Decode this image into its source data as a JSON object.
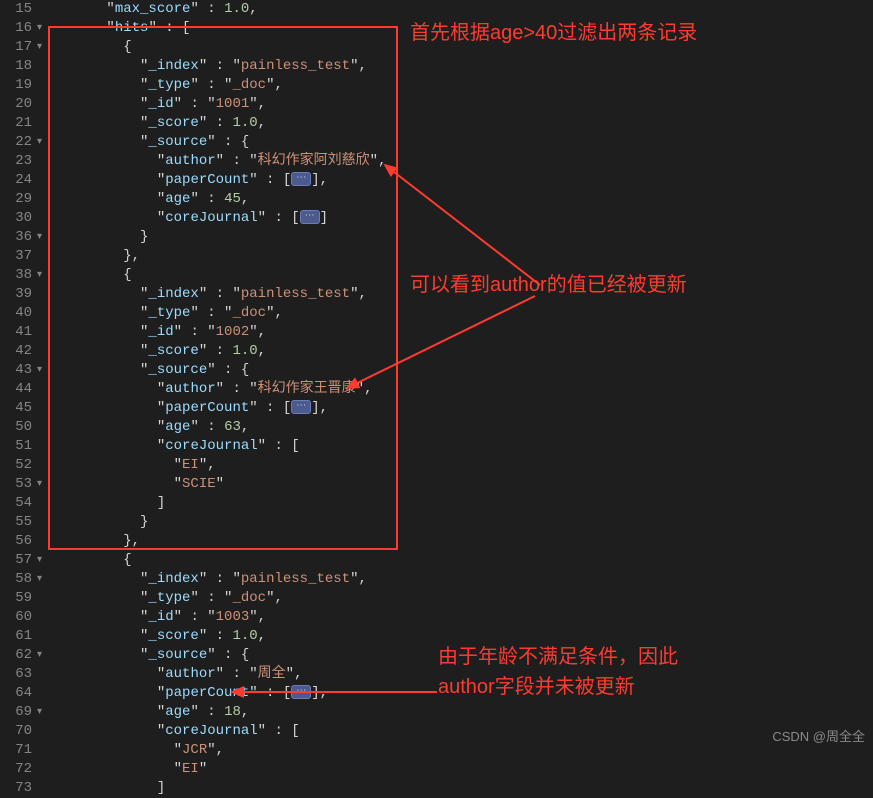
{
  "gutter": [
    "15",
    "16",
    "17",
    "18",
    "19",
    "20",
    "21",
    "22",
    "23",
    "24",
    "29",
    "30",
    "36",
    "37",
    "38",
    "39",
    "40",
    "41",
    "42",
    "43",
    "44",
    "45",
    "50",
    "51",
    "52",
    "53",
    "54",
    "55",
    "56",
    "57",
    "58",
    "59",
    "60",
    "61",
    "62",
    "63",
    "64",
    "69",
    "70",
    "71",
    "72",
    "73"
  ],
  "folds": [
    1,
    2,
    7,
    12,
    14,
    19,
    25,
    29,
    30,
    34,
    37
  ],
  "lines": {
    "l0": {
      "indent": 6,
      "pre": "\"",
      "key": "max_score",
      "post": "\" : ",
      "val_num": "1.0",
      "trail": ","
    },
    "l1": {
      "indent": 6,
      "pre": "\"",
      "key": "hits",
      "post": "\" : ["
    },
    "l2": {
      "indent": 8,
      "plain": "{"
    },
    "l3": {
      "indent": 10,
      "pre": "\"",
      "key": "_index",
      "post": "\" : \"",
      "val_str": "painless_test",
      "trail": "\","
    },
    "l4": {
      "indent": 10,
      "pre": "\"",
      "key": "_type",
      "post": "\" : \"",
      "val_str": "_doc",
      "trail": "\","
    },
    "l5": {
      "indent": 10,
      "pre": "\"",
      "key": "_id",
      "post": "\" : \"",
      "val_str": "1001",
      "trail": "\","
    },
    "l6": {
      "indent": 10,
      "pre": "\"",
      "key": "_score",
      "post": "\" : ",
      "val_num": "1.0",
      "trail": ","
    },
    "l7": {
      "indent": 10,
      "pre": "\"",
      "key": "_source",
      "post": "\" : {"
    },
    "l8": {
      "indent": 12,
      "pre": "\"",
      "key": "author",
      "post": "\" : \"",
      "val_str": "科幻作家阿刘慈欣",
      "trail": "\","
    },
    "l9": {
      "indent": 12,
      "pre": "\"",
      "key": "paperCount",
      "post": "\" : [",
      "badge": "⋯",
      "trail": "],"
    },
    "l10": {
      "indent": 12,
      "pre": "\"",
      "key": "age",
      "post": "\" : ",
      "val_num": "45",
      "trail": ","
    },
    "l11": {
      "indent": 12,
      "pre": "\"",
      "key": "coreJournal",
      "post": "\" : [",
      "badge": "⋯",
      "trail": "]"
    },
    "l12": {
      "indent": 10,
      "plain": "}"
    },
    "l13": {
      "indent": 8,
      "plain": "},"
    },
    "l14": {
      "indent": 8,
      "plain": "{"
    },
    "l15": {
      "indent": 10,
      "pre": "\"",
      "key": "_index",
      "post": "\" : \"",
      "val_str": "painless_test",
      "trail": "\","
    },
    "l16": {
      "indent": 10,
      "pre": "\"",
      "key": "_type",
      "post": "\" : \"",
      "val_str": "_doc",
      "trail": "\","
    },
    "l17": {
      "indent": 10,
      "pre": "\"",
      "key": "_id",
      "post": "\" : \"",
      "val_str": "1002",
      "trail": "\","
    },
    "l18": {
      "indent": 10,
      "pre": "\"",
      "key": "_score",
      "post": "\" : ",
      "val_num": "1.0",
      "trail": ","
    },
    "l19": {
      "indent": 10,
      "pre": "\"",
      "key": "_source",
      "post": "\" : {"
    },
    "l20": {
      "indent": 12,
      "pre": "\"",
      "key": "author",
      "post": "\" : \"",
      "val_str": "科幻作家王晋康",
      "trail": "\","
    },
    "l21": {
      "indent": 12,
      "pre": "\"",
      "key": "paperCount",
      "post": "\" : [",
      "badge": "⋯",
      "trail": "],"
    },
    "l22": {
      "indent": 12,
      "pre": "\"",
      "key": "age",
      "post": "\" : ",
      "val_num": "63",
      "trail": ","
    },
    "l23": {
      "indent": 12,
      "pre": "\"",
      "key": "coreJournal",
      "post": "\" : ["
    },
    "l24": {
      "indent": 14,
      "pre": "\"",
      "val_str": "EI",
      "trail": "\","
    },
    "l25": {
      "indent": 14,
      "pre": "\"",
      "val_str": "SCIE",
      "trail": "\""
    },
    "l26": {
      "indent": 12,
      "plain": "]"
    },
    "l27": {
      "indent": 10,
      "plain": "}"
    },
    "l28": {
      "indent": 8,
      "plain": "},"
    },
    "l29": {
      "indent": 8,
      "plain": "{"
    },
    "l30": {
      "indent": 10,
      "pre": "\"",
      "key": "_index",
      "post": "\" : \"",
      "val_str": "painless_test",
      "trail": "\","
    },
    "l31": {
      "indent": 10,
      "pre": "\"",
      "key": "_type",
      "post": "\" : \"",
      "val_str": "_doc",
      "trail": "\","
    },
    "l32": {
      "indent": 10,
      "pre": "\"",
      "key": "_id",
      "post": "\" : \"",
      "val_str": "1003",
      "trail": "\","
    },
    "l33": {
      "indent": 10,
      "pre": "\"",
      "key": "_score",
      "post": "\" : ",
      "val_num": "1.0",
      "trail": ","
    },
    "l34": {
      "indent": 10,
      "pre": "\"",
      "key": "_source",
      "post": "\" : {"
    },
    "l35": {
      "indent": 12,
      "pre": "\"",
      "key": "author",
      "post": "\" : \"",
      "val_str": "周全",
      "trail": "\","
    },
    "l36": {
      "indent": 12,
      "pre": "\"",
      "key": "paperCount",
      "post": "\" : [",
      "badge": "⋯",
      "trail": "],"
    },
    "l37": {
      "indent": 12,
      "pre": "\"",
      "key": "age",
      "post": "\" : ",
      "val_num": "18",
      "trail": ","
    },
    "l38": {
      "indent": 12,
      "pre": "\"",
      "key": "coreJournal",
      "post": "\" : ["
    },
    "l39": {
      "indent": 14,
      "pre": "\"",
      "val_str": "JCR",
      "trail": "\","
    },
    "l40": {
      "indent": 14,
      "pre": "\"",
      "val_str": "EI",
      "trail": "\""
    },
    "l41": {
      "indent": 12,
      "plain": "]"
    }
  },
  "annotations": {
    "a1": "首先根据age>40过滤出两条记录",
    "a2": "可以看到author的值已经被更新",
    "a3_l1": "由于年龄不满足条件，因此",
    "a3_l2": "author字段并未被更新"
  },
  "watermark": "CSDN @周全全"
}
